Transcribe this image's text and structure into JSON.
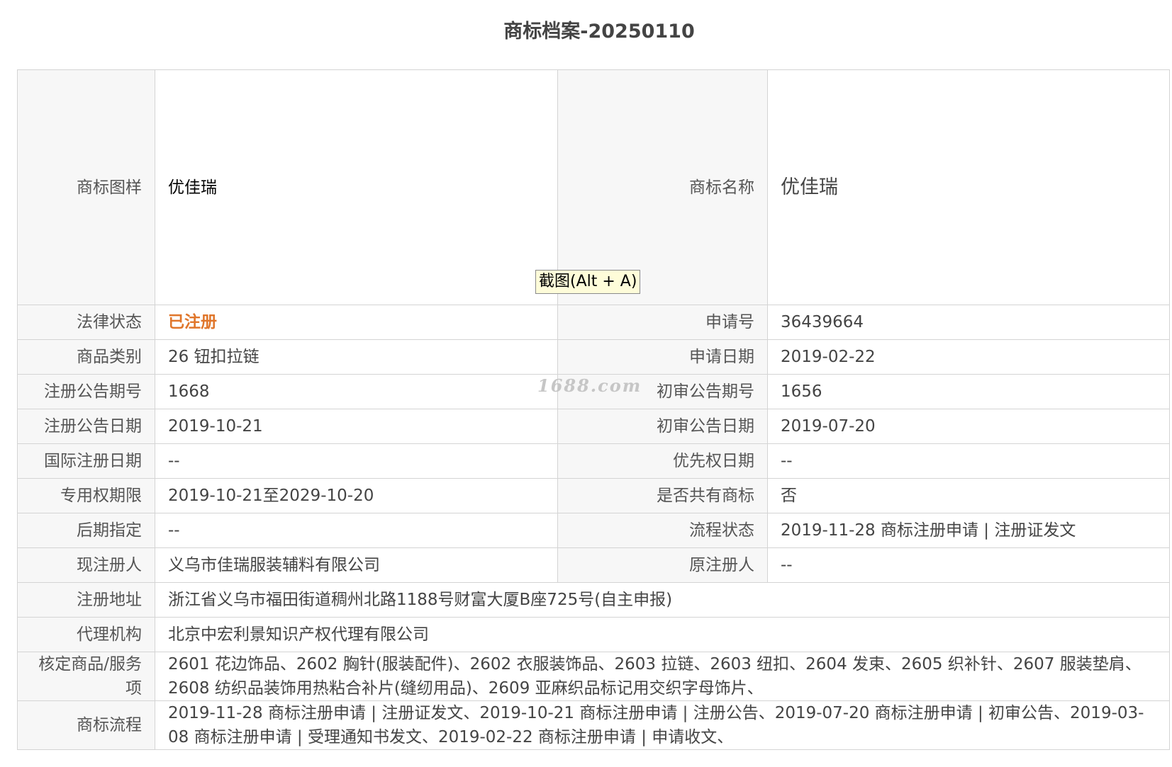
{
  "page": {
    "title": "商标档案-20250110"
  },
  "record": {
    "logo_label": "商标图样",
    "logo_text": "优佳瑞",
    "name_label": "商标名称",
    "name_value": "优佳瑞",
    "rows": [
      {
        "l1": "法律状态",
        "v1": "已注册",
        "l2": "申请号",
        "v2": "36439664"
      },
      {
        "l1": "商品类别",
        "v1": "26 钮扣拉链",
        "l2": "申请日期",
        "v2": "2019-02-22"
      },
      {
        "l1": "注册公告期号",
        "v1": "1668",
        "l2": "初审公告期号",
        "v2": "1656"
      },
      {
        "l1": "注册公告日期",
        "v1": "2019-10-21",
        "l2": "初审公告日期",
        "v2": "2019-07-20"
      },
      {
        "l1": "国际注册日期",
        "v1": "--",
        "l2": "优先权日期",
        "v2": "--"
      },
      {
        "l1": "专用权期限",
        "v1": "2019-10-21至2029-10-20",
        "l2": "是否共有商标",
        "v2": "否"
      },
      {
        "l1": "后期指定",
        "v1": "--",
        "l2": "流程状态",
        "v2": "2019-11-28 商标注册申请 | 注册证发文"
      },
      {
        "l1": "现注册人",
        "v1": "义乌市佳瑞服装辅料有限公司",
        "l2": "原注册人",
        "v2": "--"
      }
    ],
    "address_label": "注册地址",
    "address_value": "浙江省义乌市福田街道稠州北路1188号财富大厦B座725号(自主申报)",
    "agency_label": "代理机构",
    "agency_value": "北京中宏利景知识产权代理有限公司",
    "goods_label": "核定商品/服务项",
    "goods_value": "2601 花边饰品、2602 胸针(服装配件)、2602 衣服装饰品、2603 拉链、2603 纽扣、2604 发束、2605 织补针、2607 服装垫肩、2608 纺织品装饰用热粘合补片(缝纫用品)、2609 亚麻织品标记用交织字母饰片、",
    "flow_label": "商标流程",
    "flow_value": "2019-11-28 商标注册申请 | 注册证发文、2019-10-21 商标注册申请 | 注册公告、2019-07-20 商标注册申请 | 初审公告、2019-03-08 商标注册申请 | 受理通知书发文、2019-02-22 商标注册申请 | 申请收文、"
  },
  "overlay": {
    "tooltip": "截图(Alt + A)",
    "watermark": "1688.com"
  },
  "colors": {
    "status": "#e0762b",
    "label_bg": "#f7f7f7",
    "border": "#d4d4d4"
  }
}
